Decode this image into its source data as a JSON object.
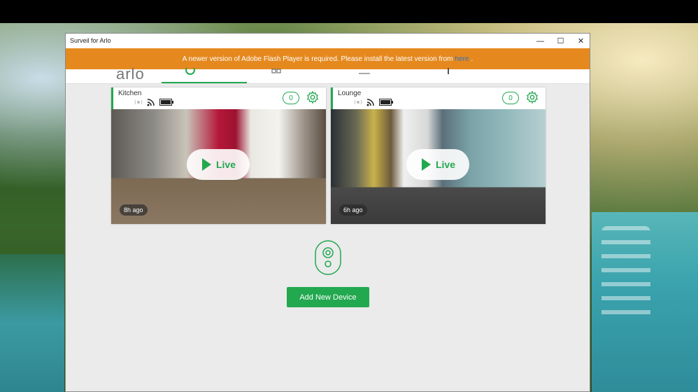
{
  "window": {
    "title": "Surveil for Arlo",
    "controls": {
      "minimize": "—",
      "maximize": "☐",
      "close": "✕"
    }
  },
  "banner": {
    "message": "A newer version of Adobe Flash Player is required. Please install the latest version from",
    "link": "here",
    "suffix": ".",
    "background": "#e5891e"
  },
  "nav": {
    "logo": "arlo",
    "active_index": 0
  },
  "cameras": [
    {
      "name": "Kitchen",
      "count": "0",
      "live_label": "Live",
      "last_seen": "8h ago"
    },
    {
      "name": "Lounge",
      "count": "0",
      "live_label": "Live",
      "last_seen": "6h ago"
    }
  ],
  "add_device": {
    "label": "Add New Device"
  },
  "colors": {
    "accent": "#22a84f",
    "banner": "#e5891e",
    "link": "#2b73c9"
  }
}
